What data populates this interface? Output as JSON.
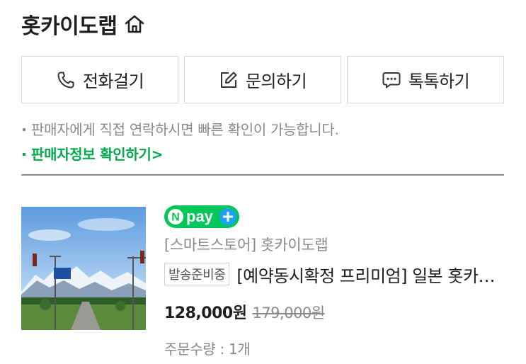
{
  "shop": {
    "name": "홋카이도랩",
    "home_icon": "home-icon"
  },
  "actions": [
    {
      "label": "전화걸기",
      "icon": "phone-icon"
    },
    {
      "label": "문의하기",
      "icon": "edit-icon"
    },
    {
      "label": "톡톡하기",
      "icon": "chat-icon"
    }
  ],
  "notice": "판매자에게 직접 연락하시면 빠른 확인이 가능합니다.",
  "seller_info_link": "판매자정보 확인하기",
  "seller_info_arrow": ">",
  "product": {
    "npay_label": "pay",
    "npay_n": "N",
    "store": "[스마트스토어] 홋카이도랩",
    "badge": "발송준비중",
    "name": "[예약동시확정 프리미엄] 일본 홋카이도 렌터카 여행",
    "price": "128,000원",
    "original_price": "179,000원",
    "quantity": "주문수량 : 1개"
  },
  "colors": {
    "accent_green": "#03a94d",
    "npay_green": "#03c75a",
    "npay_blue": "#1ea1f2",
    "muted_text": "#8a8a8a"
  }
}
